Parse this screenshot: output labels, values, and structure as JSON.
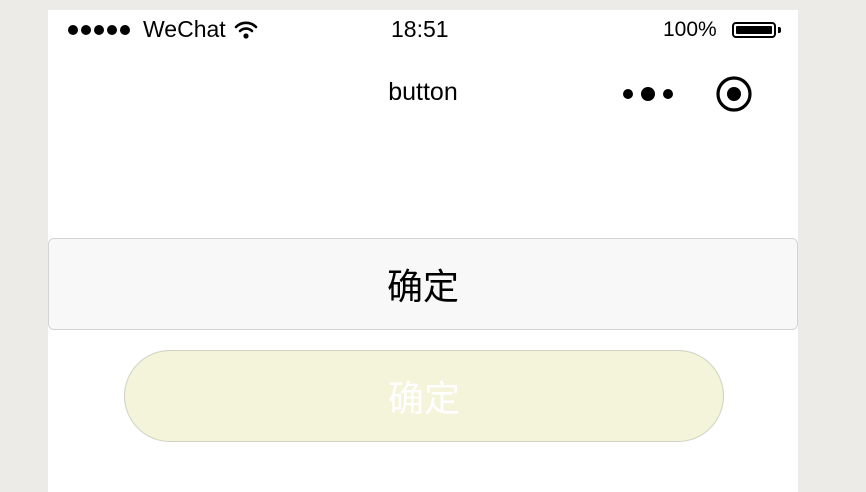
{
  "status_bar": {
    "carrier": "WeChat",
    "time": "18:51",
    "battery_percent": "100%",
    "signal_icon": "signal-dots-icon",
    "wifi_icon": "wifi-icon",
    "battery_icon": "battery-icon",
    "battery_level": 1.0
  },
  "nav_bar": {
    "title": "button",
    "menu_icon": "more-dots-icon",
    "close_icon": "target-close-icon"
  },
  "buttons": {
    "default_label": "确定",
    "round_label": "确定"
  },
  "colors": {
    "page_background": "#ecebe8",
    "screen_background": "#ffffff",
    "default_button_bg": "#f8f8f8",
    "round_button_bg": "#f4f4da",
    "round_button_text": "#ffffff"
  }
}
